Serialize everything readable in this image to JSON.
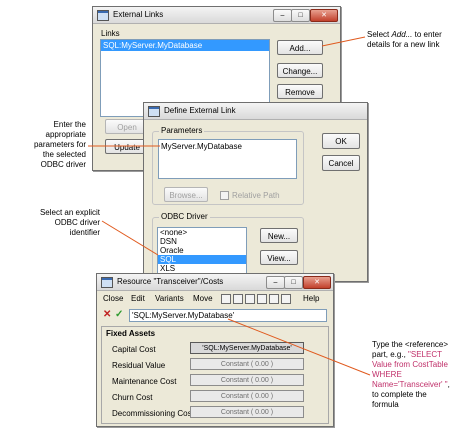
{
  "external_links": {
    "title": "External Links",
    "links_label": "Links",
    "link_items": [
      "SQL:MyServer.MyDatabase"
    ],
    "add": "Add...",
    "change": "Change...",
    "remove": "Remove",
    "open": "Open",
    "update": "Update"
  },
  "define_link": {
    "title": "Define External Link",
    "parameters_label": "Parameters",
    "parameters_value": "MyServer.MyDatabase",
    "browse": "Browse...",
    "relative_path": "Relative Path",
    "ok": "OK",
    "cancel": "Cancel",
    "odbc_label": "ODBC Driver",
    "drivers": [
      "<none>",
      "DSN",
      "Oracle",
      "SQL",
      "XLS"
    ],
    "selected_driver": "SQL",
    "new": "New...",
    "view": "View..."
  },
  "resource_window": {
    "title": "Resource \"Transceiver\"/Costs",
    "menu": [
      "Close",
      "Edit",
      "Variants",
      "Move",
      "Help"
    ],
    "formula_value": "'SQL:MyServer.MyDatabase'",
    "section": "Fixed Assets",
    "rows": [
      {
        "label": "Capital Cost",
        "value": "'SQL:MyServer.MyDatabase'"
      },
      {
        "label": "Residual Value",
        "value": "Constant ( 0.00 )"
      },
      {
        "label": "Maintenance Cost",
        "value": "Constant ( 0.00 )"
      },
      {
        "label": "Churn Cost",
        "value": "Constant ( 0.00 )"
      },
      {
        "label": "Decommissioning Cost",
        "value": "Constant ( 0.00 )"
      }
    ]
  },
  "annotations": {
    "add_note_1": "Select ",
    "add_note_em": "Add...",
    "add_note_2": " to enter",
    "add_note_3": "details for a new link",
    "params_note": [
      "Enter the",
      "appropriate",
      "parameters for",
      "the selected",
      "ODBC driver"
    ],
    "odbc_note": [
      "Select an explicit",
      "ODBC driver",
      "identifier"
    ],
    "ref_note_1": "Type the <reference>",
    "ref_note_2": "part, e.g., ",
    "ref_note_3": "\"SELECT",
    "ref_note_4": "Value from CostTable",
    "ref_note_5": "WHERE",
    "ref_note_6": "Name='Transceiver' \"",
    "ref_note_7": ",",
    "ref_note_8": "to complete the",
    "ref_note_9": "formula"
  },
  "colors": {
    "selection": "#3399ff",
    "annotation_line": "#e05a1e",
    "sql_example": "#c0306a"
  },
  "icons": [
    "app-icon",
    "minimize-icon",
    "maximize-icon",
    "close-icon",
    "cancel-x-icon",
    "accept-check-icon"
  ]
}
